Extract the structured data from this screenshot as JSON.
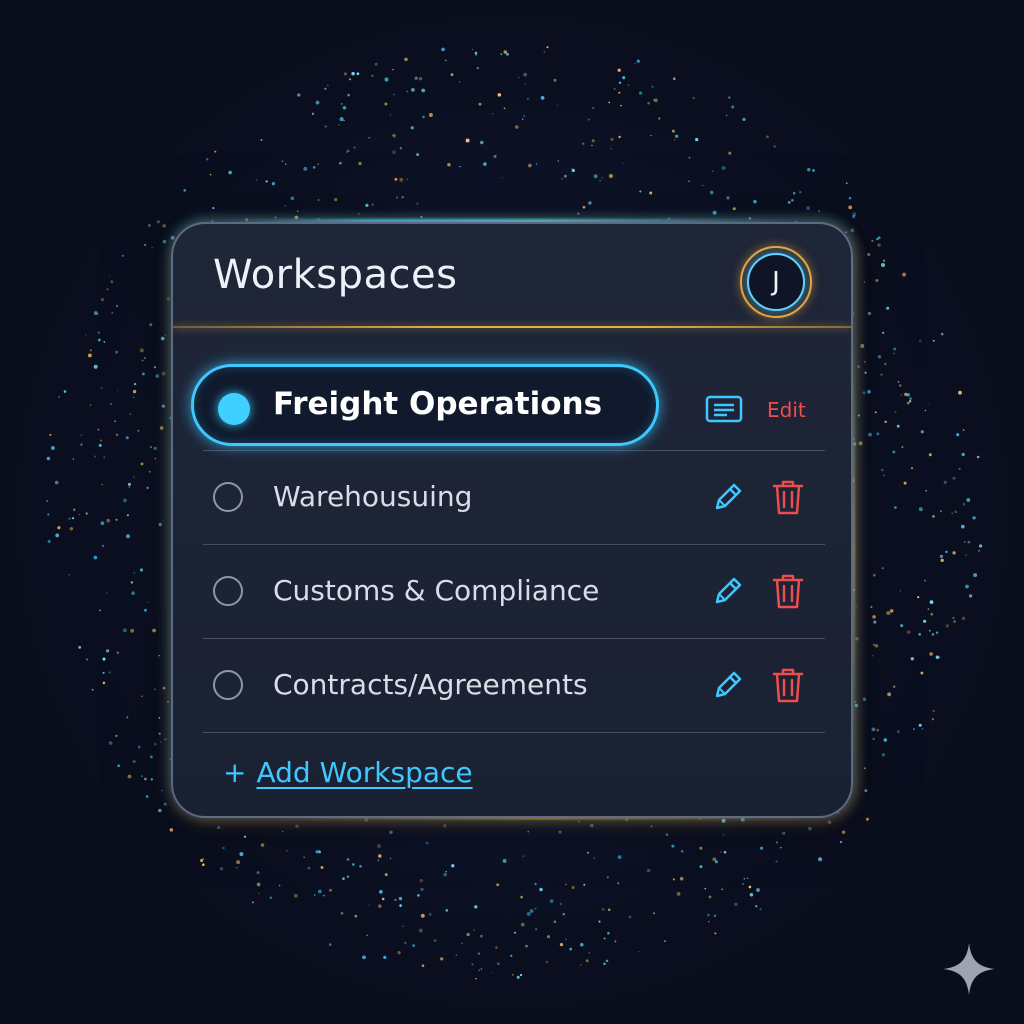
{
  "header": {
    "title": "Workspaces",
    "avatar_initial": "J"
  },
  "workspaces": [
    {
      "label": "Freight Operations",
      "selected": true,
      "actions": {
        "icon": "document-icon",
        "edit_label": "Edit"
      }
    },
    {
      "label": "Warehousuing",
      "selected": false,
      "actions": {
        "edit_icon": "pencil-icon",
        "delete_icon": "trash-icon"
      }
    },
    {
      "label": "Customs & Compliance",
      "selected": false,
      "actions": {
        "edit_icon": "pencil-icon",
        "delete_icon": "trash-icon"
      }
    },
    {
      "label": "Contracts/Agreements",
      "selected": false,
      "actions": {
        "edit_icon": "pencil-icon",
        "delete_icon": "trash-icon"
      }
    }
  ],
  "add_workspace": {
    "plus": "+",
    "label": "Add Workspace"
  },
  "colors": {
    "accent_cyan": "#3fc7ff",
    "accent_gold": "#e3a640",
    "danger_red": "#ee4d4d",
    "panel_bg": "#1d2436",
    "page_bg": "#0b1022"
  }
}
